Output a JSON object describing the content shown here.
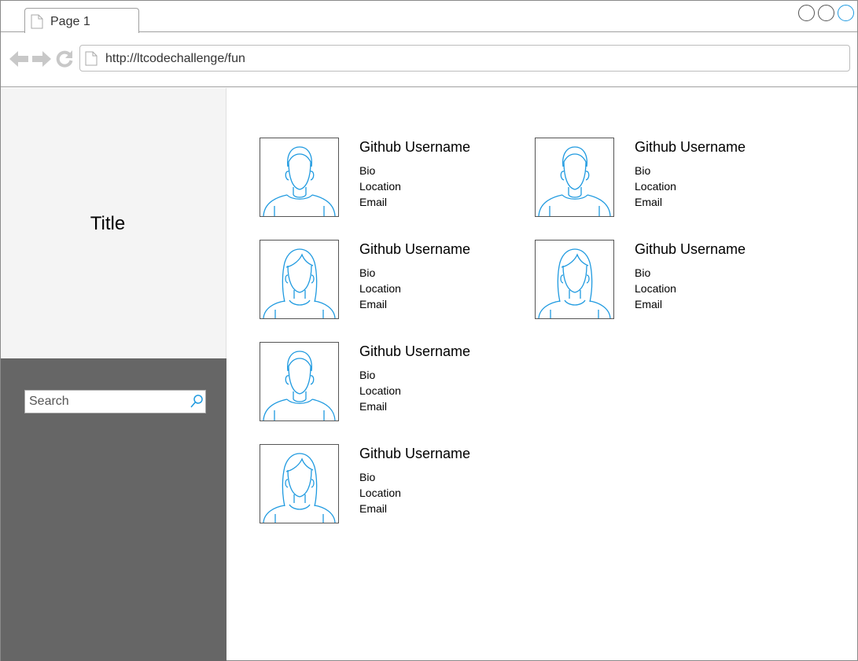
{
  "browser": {
    "tab_label": "Page 1",
    "url": "http://ltcodechallenge/fun",
    "accent_color": "#1f9ae0"
  },
  "sidebar": {
    "title": "Title",
    "search_placeholder": "Search"
  },
  "users": [
    {
      "username": "Github Username",
      "bio": "Bio",
      "location": "Location",
      "email": "Email",
      "avatar": "male-avatar-icon"
    },
    {
      "username": "Github Username",
      "bio": "Bio",
      "location": "Location",
      "email": "Email",
      "avatar": "male-avatar-icon"
    },
    {
      "username": "Github Username",
      "bio": "Bio",
      "location": "Location",
      "email": "Email",
      "avatar": "female-avatar-icon"
    },
    {
      "username": "Github Username",
      "bio": "Bio",
      "location": "Location",
      "email": "Email",
      "avatar": "female-avatar-icon"
    },
    {
      "username": "Github Username",
      "bio": "Bio",
      "location": "Location",
      "email": "Email",
      "avatar": "male-avatar-icon"
    },
    {
      "username": "Github Username",
      "bio": "Bio",
      "location": "Location",
      "email": "Email",
      "avatar": "female-avatar-icon"
    }
  ]
}
